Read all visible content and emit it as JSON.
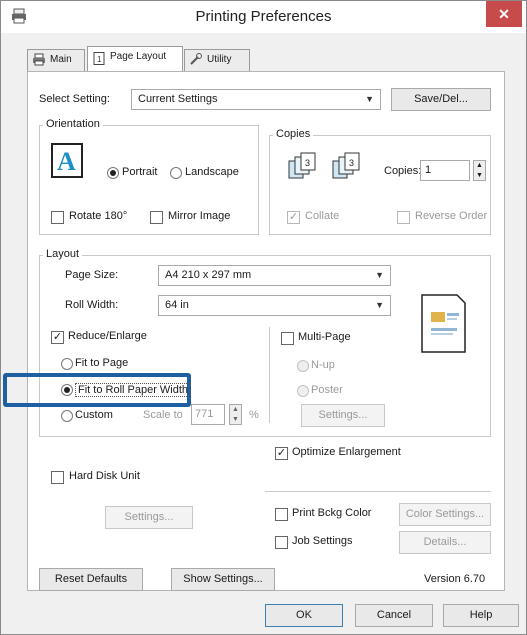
{
  "window": {
    "title": "Printing Preferences",
    "close_glyph": "✕"
  },
  "tabs": [
    {
      "label": "Main",
      "icon": "printer-icon"
    },
    {
      "label": "Page Layout",
      "icon": "page-icon"
    },
    {
      "label": "Utility",
      "icon": "wrench-icon"
    }
  ],
  "select_setting": {
    "label": "Select Setting:",
    "value": "Current Settings",
    "save_button": "Save/Del..."
  },
  "orientation": {
    "title": "Orientation",
    "portrait": "Portrait",
    "landscape": "Landscape",
    "rotate": "Rotate 180°",
    "mirror": "Mirror Image"
  },
  "copies": {
    "title": "Copies",
    "label": "Copies:",
    "value": "1",
    "collate": "Collate",
    "reverse": "Reverse Order"
  },
  "layout": {
    "title": "Layout",
    "page_size_label": "Page Size:",
    "page_size_value": "A4 210 x 297 mm",
    "roll_width_label": "Roll Width:",
    "roll_width_value": "64 in",
    "reduce_enlarge": "Reduce/Enlarge",
    "fit_to_page": "Fit to Page",
    "fit_to_roll": "Fit to Roll Paper Width",
    "custom": "Custom",
    "scale_to": "Scale to",
    "scale_value": "771",
    "percent": "%",
    "multi_page": "Multi-Page",
    "n_up": "N-up",
    "poster": "Poster",
    "settings_button": "Settings..."
  },
  "optimize_enlargement": "Optimize Enlargement",
  "hard_disk_unit": "Hard Disk Unit",
  "hdd_settings_button": "Settings...",
  "print_bckg_color": "Print Bckg Color",
  "color_settings_button": "Color Settings...",
  "job_settings": "Job Settings",
  "details_button": "Details...",
  "reset_defaults": "Reset Defaults",
  "show_settings": "Show Settings...",
  "version": "Version 6.70",
  "ok": "OK",
  "cancel": "Cancel",
  "help": "Help",
  "colors": {
    "highlight": "#1d5fa0",
    "close": "#c74b4b"
  }
}
